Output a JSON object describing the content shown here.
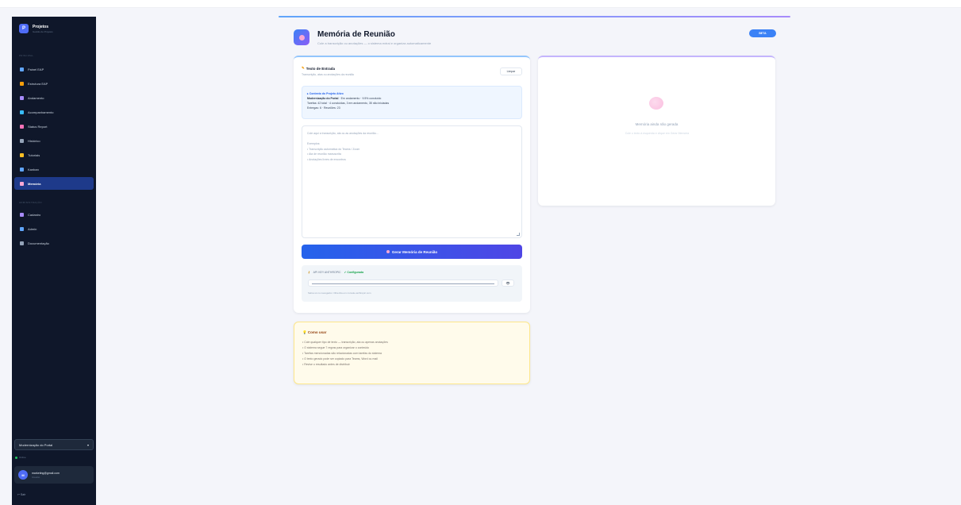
{
  "sidebar": {
    "brand": {
      "logo": "P",
      "name": "Projetos",
      "subtitle": "Gestão de Projetos"
    },
    "section_main": "Principal",
    "items_main": [
      {
        "label": "Painel EAP",
        "icon": "grid-icon",
        "color": "#60a5fa"
      },
      {
        "label": "Estrutura EAP",
        "icon": "hierarchy-icon",
        "color": "#f59e0b"
      },
      {
        "label": "Andamento",
        "icon": "trend-icon",
        "color": "#a78bfa"
      },
      {
        "label": "Acompanhamento",
        "icon": "chart-icon",
        "color": "#38bdf8"
      },
      {
        "label": "Status Report",
        "icon": "report-icon",
        "color": "#f472b6"
      },
      {
        "label": "Histórico",
        "icon": "history-icon",
        "color": "#94a3b8"
      },
      {
        "label": "Tutoriais",
        "icon": "book-icon",
        "color": "#fbbf24"
      },
      {
        "label": "Kanban",
        "icon": "kanban-icon",
        "color": "#60a5fa"
      },
      {
        "label": "Memória",
        "icon": "brain-icon",
        "color": "#f9a8d4",
        "active": true
      }
    ],
    "section_admin": "Administração",
    "items_admin": [
      {
        "label": "Cadastro",
        "icon": "database-icon",
        "color": "#a78bfa"
      },
      {
        "label": "Admin",
        "icon": "shield-icon",
        "color": "#60a5fa"
      },
      {
        "label": "Documentação",
        "icon": "doc-icon",
        "color": "#94a3b8"
      }
    ],
    "project_select": "Modernização do Portal",
    "online": "Online",
    "user": {
      "initials": "M",
      "email": "marketing@gmail.com",
      "role": "Usuário"
    },
    "logout": "Sair"
  },
  "header": {
    "title": "Memória de Reunião",
    "subtitle": "Cole a transcrição ou anotações — o sistema extrai e organiza automaticamente",
    "badge": "BETA"
  },
  "input_card": {
    "title": "Texto de Entrada",
    "subtitle": "Transcrição, atas ou anotações da reunião",
    "clear_button": "Limpar",
    "context": {
      "title": "Contexto do Projeto Ativo",
      "line1_bold": "Modernização do Portal",
      "line1_rest": " · Em andamento · 9.5% concluído",
      "line2": "Tarefas: 42 total · 4 concluídas, 3 em andamento, 35 não iniciadas",
      "line3": "Entregas: 6 · Reuniões: 23"
    },
    "textarea_lines": [
      "Cole aqui a transcrição, ata ou as anotações da reunião...",
      "",
      "Exemplos:",
      "• Transcrição automática do Teams / Zoom",
      "• Ata de reunião manuscrita",
      "• Anotações livres de encontros"
    ],
    "generate_button": "Gerar Memória de Reunião",
    "api": {
      "label": "API KEY ANTHROPIC",
      "status": "✓ Configurada",
      "eye": "👁",
      "note": "Salva só no navegador. Obtenha em console.anthropic.com"
    }
  },
  "output_card": {
    "title": "Memória ainda não gerada",
    "subtitle": "Cole o texto à esquerda e clique em Gerar Memória"
  },
  "help_card": {
    "title": "Como usar",
    "items": [
      "• Cole qualquer tipo de texto — transcrição, ata ou apenas anotações",
      "• O sistema segue 7 regras para organizar o conteúdo",
      "• Tarefas mencionadas são relacionadas com tarefas do sistema",
      "• O texto gerado pode ser copiado para Teams, Word ou mail",
      "• Revise o resultado antes de distribuir"
    ]
  }
}
